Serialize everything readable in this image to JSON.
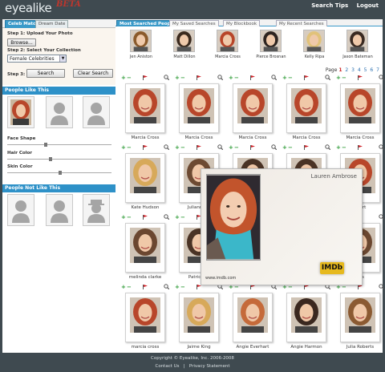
{
  "header": {
    "logo": "eyealike",
    "beta": "BETA",
    "links": [
      "Search Tips",
      "Logout"
    ]
  },
  "left": {
    "tabs": [
      "Celeb Match",
      "Dream Date"
    ],
    "step1": "Step 1: Upload Your Photo",
    "browse": "Browse...",
    "step2": "Step 2: Select Your Collection",
    "collection": "Female Celebrities",
    "step3": "Step 3:",
    "search": "Search",
    "clear": "Clear Search",
    "like_header": "People Like This",
    "notlike_header": "People Not Like This",
    "sliders": [
      "Face Shape",
      "Hair Color",
      "Skin Color"
    ]
  },
  "main": {
    "tabs": [
      "Most Searched People",
      "My Saved Searches",
      "My Blockbook",
      "My Recent Searches"
    ],
    "recent": [
      "Jen Aniston",
      "Matt Dillon",
      "Marcia Cross",
      "Pierce Brosnan",
      "Kelly Ripa",
      "Jason Bateman"
    ],
    "pager_label": "Page",
    "current_page": "1",
    "pages": [
      "2",
      "3",
      "4",
      "5",
      "6",
      "7"
    ],
    "cards": [
      [
        "Marcia Cross",
        "Marcia Cross",
        "Marcia Cross",
        "Marcia Cross",
        "Marcia Cross"
      ],
      [
        "Kate Hudson",
        "Julianne M",
        "",
        "",
        "heart"
      ],
      [
        "melinda clarke",
        "Patricia H",
        "",
        "",
        "nes"
      ],
      [
        "marcia cross",
        "Jaime King",
        "Angie Everhart",
        "Angie Harmon",
        "Julia Roberts"
      ]
    ]
  },
  "popup": {
    "name": "Lauren Ambrose",
    "url": "www.imdb.com",
    "badge": "IMDb"
  },
  "footer": {
    "copyright": "Copyright © Eyealike, Inc. 2006-2008",
    "contact": "Contact Us",
    "sep": "|",
    "privacy": "Privacy Statement"
  },
  "colors": {
    "accent": "#2e91c8",
    "background": "#3f4a50",
    "hair_red": "#b8462a"
  }
}
